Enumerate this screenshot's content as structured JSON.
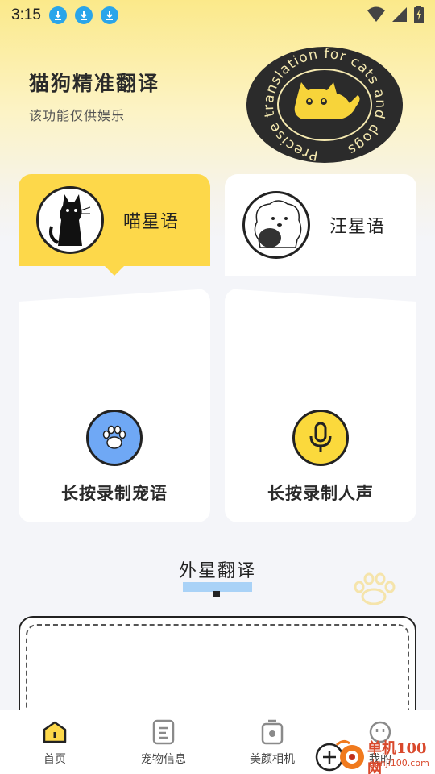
{
  "status_bar": {
    "time": "3:15",
    "icons": [
      "download-icon",
      "download-icon",
      "download-icon",
      "wifi-icon",
      "signal-icon",
      "battery-icon"
    ]
  },
  "header": {
    "title": "猫狗精准翻译",
    "subtitle": "该功能仅供娱乐",
    "badge_text": "Precise translation for cats and dogs"
  },
  "tabs": [
    {
      "label": "喵星语",
      "icon": "black-cat-avatar",
      "selected": true
    },
    {
      "label": "汪星语",
      "icon": "white-dog-avatar",
      "selected": false
    }
  ],
  "record": {
    "pet_label": "长按录制宠语",
    "human_label": "长按录制人声"
  },
  "section": {
    "title": "外星翻译"
  },
  "bottom_nav": [
    {
      "label": "首页",
      "icon": "home-icon",
      "active": true
    },
    {
      "label": "宠物信息",
      "icon": "document-icon",
      "active": false
    },
    {
      "label": "美颜相机",
      "icon": "camera-icon",
      "active": false
    },
    {
      "label": "我的",
      "icon": "profile-icon",
      "active": false
    }
  ],
  "watermark": {
    "name": "单机100网",
    "url": "danji100.com"
  },
  "colors": {
    "accent_yellow": "#fdd84a",
    "paw_blue": "#6fa8f5",
    "underline_blue": "#a9d2f7",
    "download_blue": "#2aa5ea"
  }
}
